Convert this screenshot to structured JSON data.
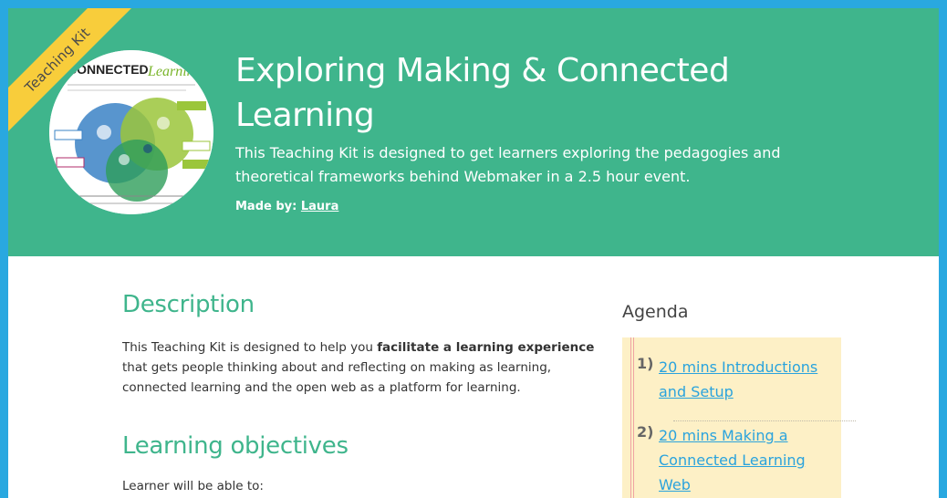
{
  "hero": {
    "ribbon": "Teaching Kit",
    "title": "Exploring Making & Connected Learning",
    "subtitle": "This Teaching Kit is designed to get learners exploring the pedagogies and theoretical frameworks behind Webmaker in a 2.5 hour event.",
    "made_by_label": "Made by:",
    "author": "Laura",
    "thumbnail_title": "CONNECTED Learning"
  },
  "description": {
    "heading": "Description",
    "text_before": "This Teaching Kit is designed to help you ",
    "text_bold": "facilitate a learning experience",
    "text_after": " that gets people thinking about and reflecting on making as learning, connected learning and the open web as a platform for learning."
  },
  "objectives": {
    "heading": "Learning objectives",
    "intro": "Learner will be able to:"
  },
  "agenda": {
    "title": "Agenda",
    "items": [
      {
        "number": "1)",
        "label": "20 mins Introductions and Setup"
      },
      {
        "number": "2)",
        "label": "20 mins Making a Connected Learning Web"
      }
    ]
  },
  "colors": {
    "page_background": "#29a8e0",
    "hero_background": "#3fb58c",
    "ribbon": "#f8cd3b",
    "heading": "#3fb58c",
    "link": "#2aa3dd",
    "agenda_background": "#fdf0c6"
  }
}
